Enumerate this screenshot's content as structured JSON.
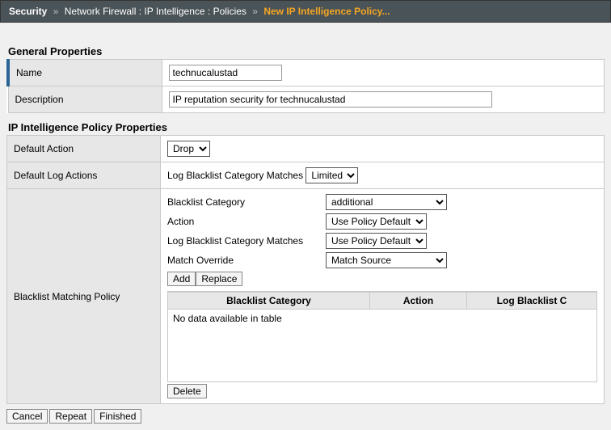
{
  "breadcrumb": {
    "root": "Security",
    "sep": "»",
    "path": "Network Firewall : IP Intelligence : Policies",
    "current": "New IP Intelligence Policy..."
  },
  "sections": {
    "general": "General Properties",
    "ip_policy": "IP Intelligence Policy Properties"
  },
  "general": {
    "name_label": "Name",
    "name_value": "technucalustad",
    "desc_label": "Description",
    "desc_value": "IP reputation security for technucalustad"
  },
  "policy": {
    "default_action_label": "Default Action",
    "default_action_value": "Drop",
    "default_log_label": "Default Log Actions",
    "log_bl_cat_matches_label": "Log Blacklist Category Matches",
    "log_bl_cat_matches_value": "Limited",
    "bl_policy_label": "Blacklist Matching Policy",
    "bl_category_label": "Blacklist Category",
    "bl_category_value": "additional",
    "action_label": "Action",
    "action_value": "Use Policy Default",
    "log_matches_value": "Use Policy Default",
    "match_override_label": "Match Override",
    "match_override_value": "Match Source",
    "add_btn": "Add",
    "replace_btn": "Replace",
    "delete_btn": "Delete",
    "table_headers": {
      "col1": "Blacklist Category",
      "col2": "Action",
      "col3": "Log Blacklist C"
    },
    "empty_text": "No data available in table"
  },
  "footer": {
    "cancel": "Cancel",
    "repeat": "Repeat",
    "finished": "Finished"
  }
}
